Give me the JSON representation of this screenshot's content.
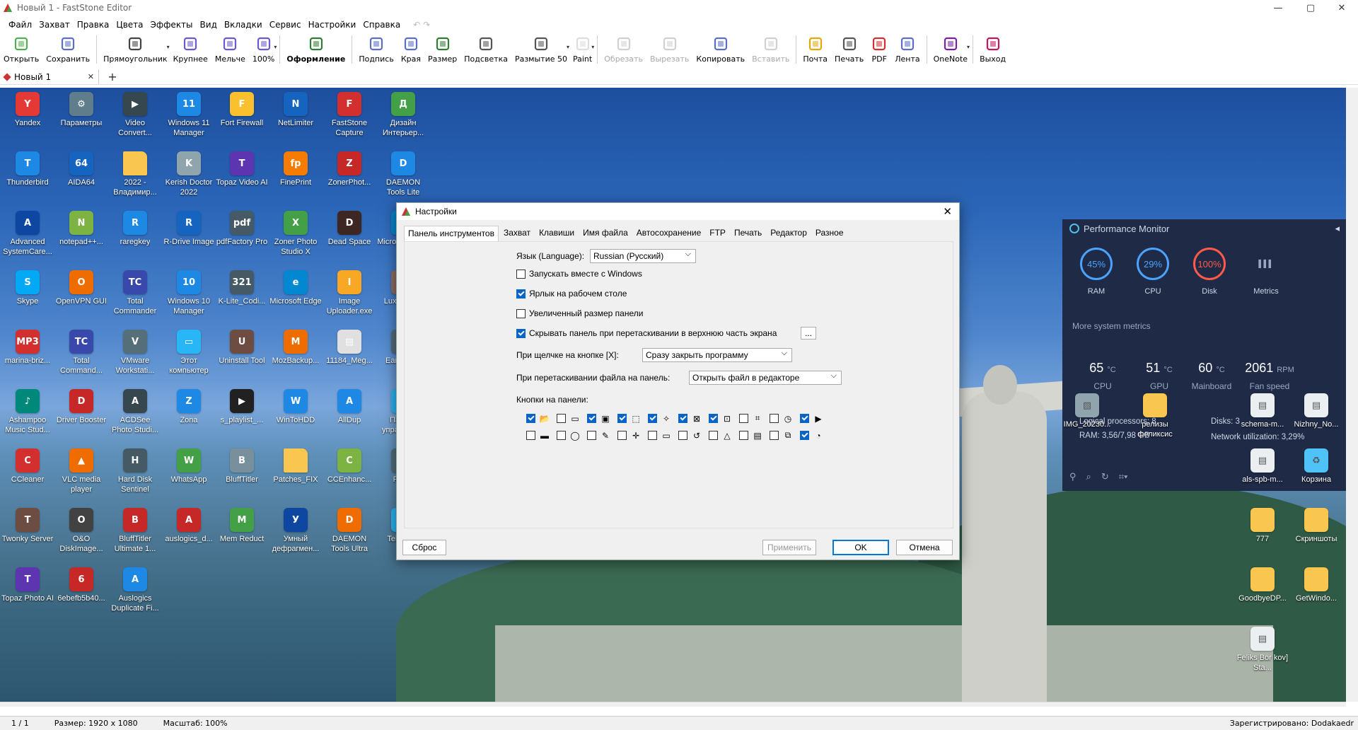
{
  "window": {
    "title": "Новый 1 - FastStone Editor",
    "min": "—",
    "max": "▢",
    "close": "✕"
  },
  "menu": [
    "Файл",
    "Захват",
    "Правка",
    "Цвета",
    "Эффекты",
    "Вид",
    "Вкладки",
    "Сервис",
    "Настройки",
    "Справка"
  ],
  "menu_undo": "↶ ↷",
  "toolbar": [
    {
      "label": "Открыть",
      "icon": "open-icon",
      "color": "#4caf50"
    },
    {
      "label": "Сохранить",
      "icon": "save-icon",
      "color": "#5a6ec9"
    },
    {
      "label": "Прямоугольник",
      "icon": "rectangle-select-icon",
      "color": "#444"
    },
    {
      "label": "Крупнее",
      "icon": "zoom-in-icon",
      "color": "#6a5acd"
    },
    {
      "label": "Мельче",
      "icon": "zoom-out-icon",
      "color": "#6a5acd"
    },
    {
      "label": "100%",
      "icon": "zoom-100-icon",
      "color": "#6a5acd"
    },
    {
      "label": "Оформление",
      "icon": "draw-icon",
      "color": "#2e7d32",
      "bold": true
    },
    {
      "label": "Подпись",
      "icon": "caption-icon",
      "color": "#5a6ec9"
    },
    {
      "label": "Края",
      "icon": "edge-icon",
      "color": "#5a6ec9"
    },
    {
      "label": "Размер",
      "icon": "resize-icon",
      "color": "#2e7d32"
    },
    {
      "label": "Подсветка",
      "icon": "spotlight-icon",
      "color": "#555"
    },
    {
      "label": "Размытие 50",
      "icon": "blur-icon",
      "color": "#555"
    },
    {
      "label": "Paint",
      "icon": "paint-icon",
      "color": "#ddd"
    },
    {
      "label": "Обрезать",
      "icon": "crop-icon",
      "color": "#999",
      "disabled": true
    },
    {
      "label": "Вырезать",
      "icon": "cut-icon",
      "color": "#999",
      "disabled": true
    },
    {
      "label": "Копировать",
      "icon": "copy-icon",
      "color": "#5a6ec9"
    },
    {
      "label": "Вставить",
      "icon": "paste-icon",
      "color": "#999",
      "disabled": true
    },
    {
      "label": "Почта",
      "icon": "mail-icon",
      "color": "#e6a700"
    },
    {
      "label": "Печать",
      "icon": "print-icon",
      "color": "#555"
    },
    {
      "label": "PDF",
      "icon": "pdf-icon",
      "color": "#d32f2f"
    },
    {
      "label": "Лента",
      "icon": "ribbon-icon",
      "color": "#5a6ec9"
    },
    {
      "label": "OneNote",
      "icon": "onenote-icon",
      "color": "#7b1fa2"
    },
    {
      "label": "Выход",
      "icon": "exit-icon",
      "color": "#c2185b"
    }
  ],
  "doc_tab": {
    "name": "Новый 1",
    "close": "✕",
    "add": "+"
  },
  "desktop_icons": [
    {
      "label": "Yandex",
      "color": "#e53935",
      "g": "Y"
    },
    {
      "label": "Параметры",
      "color": "#607d8b",
      "g": "⚙"
    },
    {
      "label": "Video Convert...",
      "color": "#37474f",
      "g": "▶"
    },
    {
      "label": "Windows 11 Manager",
      "color": "#1e88e5",
      "g": "11"
    },
    {
      "label": "Fort Firewall",
      "color": "#fbc02d",
      "g": "F"
    },
    {
      "label": "NetLimiter",
      "color": "#1565c0",
      "g": "N"
    },
    {
      "label": "FastStone Capture",
      "color": "#d32f2f",
      "g": "F"
    },
    {
      "label": "Дизайн Интерьер...",
      "color": "#43a047",
      "g": "Д"
    },
    {
      "label": "Thunderbird",
      "color": "#1e88e5",
      "g": "T"
    },
    {
      "label": "AIDA64",
      "color": "#1565c0",
      "g": "64"
    },
    {
      "label": "2022 - Владимир...",
      "color": "#f9c74f",
      "g": ""
    },
    {
      "label": "Kerish Doctor 2022",
      "color": "#90a4ae",
      "g": "K"
    },
    {
      "label": "Topaz Video AI",
      "color": "#5e35b1",
      "g": "T"
    },
    {
      "label": "FinePrint",
      "color": "#f57c00",
      "g": "fp"
    },
    {
      "label": "ZonerPhot...",
      "color": "#c62828",
      "g": "Z"
    },
    {
      "label": "DAEMON Tools Lite",
      "color": "#1e88e5",
      "g": "D"
    },
    {
      "label": "Advanced SystemCare...",
      "color": "#0d47a1",
      "g": "A"
    },
    {
      "label": "notepad++...",
      "color": "#7cb342",
      "g": "N"
    },
    {
      "label": "raregkey",
      "color": "#1e88e5",
      "g": "R"
    },
    {
      "label": "R-Drive Image",
      "color": "#1565c0",
      "g": "R"
    },
    {
      "label": "pdfFactory Pro",
      "color": "#455a64",
      "g": "pdf"
    },
    {
      "label": "Zoner Photo Studio X",
      "color": "#43a047",
      "g": "X"
    },
    {
      "label": "Dead Space",
      "color": "#3e2723",
      "g": "D"
    },
    {
      "label": "Microsoft Edge",
      "color": "#0288d1",
      "g": "e"
    },
    {
      "label": "Skype",
      "color": "#03a9f4",
      "g": "S"
    },
    {
      "label": "OpenVPN GUI",
      "color": "#ef6c00",
      "g": "O"
    },
    {
      "label": "Total Commander",
      "color": "#3949ab",
      "g": "TC"
    },
    {
      "label": "Windows 10 Manager",
      "color": "#1e88e5",
      "g": "10"
    },
    {
      "label": "K-Lite_Codi...",
      "color": "#455a64",
      "g": "321"
    },
    {
      "label": "Microsoft Edge",
      "color": "#0288d1",
      "g": "e"
    },
    {
      "label": "Image Uploader.exe",
      "color": "#f9a825",
      "g": "I"
    },
    {
      "label": "Luxor3.exe",
      "color": "#8d6e63",
      "g": "L"
    },
    {
      "label": "marina-briz...",
      "color": "#d32f2f",
      "g": "MP3"
    },
    {
      "label": "Total Command...",
      "color": "#3949ab",
      "g": "TC"
    },
    {
      "label": "VMware Workstati...",
      "color": "#546e7a",
      "g": "V"
    },
    {
      "label": "Этот компьютер",
      "color": "#29b6f6",
      "g": "▭"
    },
    {
      "label": "Uninstall Tool",
      "color": "#6d4c41",
      "g": "U"
    },
    {
      "label": "MozBackup...",
      "color": "#ef6c00",
      "g": "M"
    },
    {
      "label": "11184_Meg...",
      "color": "#e0e0e0",
      "g": "▤"
    },
    {
      "label": "EarthView",
      "color": "#546e7a",
      "g": "E"
    },
    {
      "label": "Ashampoo Music Stud...",
      "color": "#00897b",
      "g": "♪"
    },
    {
      "label": "Driver Booster",
      "color": "#c62828",
      "g": "D"
    },
    {
      "label": "ACDSee Photo Studi...",
      "color": "#37474f",
      "g": "A"
    },
    {
      "label": "Zona",
      "color": "#1e88e5",
      "g": "Z"
    },
    {
      "label": "s_playlist_...",
      "color": "#212121",
      "g": "▶"
    },
    {
      "label": "WinToHDD",
      "color": "#1e88e5",
      "g": "W"
    },
    {
      "label": "AllDup",
      "color": "#1e88e5",
      "g": "A"
    },
    {
      "label": "Панель управления",
      "color": "#29b6f6",
      "g": "П"
    },
    {
      "label": "CCleaner",
      "color": "#d32f2f",
      "g": "C"
    },
    {
      "label": "VLC media player",
      "color": "#ef6c00",
      "g": "▲"
    },
    {
      "label": "Hard Disk Sentinel",
      "color": "#455a64",
      "g": "H"
    },
    {
      "label": "WhatsApp",
      "color": "#43a047",
      "g": "W"
    },
    {
      "label": "BluffTitler",
      "color": "#78909c",
      "g": "B"
    },
    {
      "label": "Patches_FIX",
      "color": "#f9c74f",
      "g": ""
    },
    {
      "label": "CCEnhanc...",
      "color": "#7cb342",
      "g": "C"
    },
    {
      "label": "Rufus",
      "color": "#546e7a",
      "g": "R"
    },
    {
      "label": "Twonky Server",
      "color": "#6d4c41",
      "g": "T"
    },
    {
      "label": "O&O DiskImage...",
      "color": "#424242",
      "g": "O"
    },
    {
      "label": "BluffTitler Ultimate 1...",
      "color": "#c62828",
      "g": "B"
    },
    {
      "label": "auslogics_d...",
      "color": "#c62828",
      "g": "A"
    },
    {
      "label": "Mem Reduct",
      "color": "#43a047",
      "g": "M"
    },
    {
      "label": "Умный дефрагмен...",
      "color": "#0d47a1",
      "g": "У"
    },
    {
      "label": "DAEMON Tools Ultra",
      "color": "#ef6c00",
      "g": "D"
    },
    {
      "label": "Telegram",
      "color": "#29b6f6",
      "g": "T"
    },
    {
      "label": "Topaz Photo AI",
      "color": "#5e35b1",
      "g": "T"
    },
    {
      "label": "6ebefb5b40...",
      "color": "#c62828",
      "g": "6"
    },
    {
      "label": "Auslogics Duplicate Fi...",
      "color": "#1e88e5",
      "g": "A"
    }
  ],
  "desktop_right": [
    {
      "label": "IMG_20230...",
      "color": "#90a4ae",
      "g": "▨"
    },
    {
      "label": "релизы феликсис",
      "color": "#f9c74f",
      "g": ""
    },
    {
      "label": "schema-m...",
      "color": "#eceff1",
      "g": "▤"
    },
    {
      "label": "Nizhny_No...",
      "color": "#eceff1",
      "g": "▤"
    },
    {
      "label": "als-spb-m...",
      "color": "#eceff1",
      "g": "▤"
    },
    {
      "label": "Корзина",
      "color": "#4fc3f7",
      "g": "♻"
    },
    {
      "label": "777",
      "color": "#f9c74f",
      "g": ""
    },
    {
      "label": "Скриншоты",
      "color": "#f9c74f",
      "g": ""
    },
    {
      "label": "GoodbyeDP...",
      "color": "#f9c74f",
      "g": ""
    },
    {
      "label": "GetWindo...",
      "color": "#f9c74f",
      "g": ""
    },
    {
      "label": "Feliks Bor kov] Sta...",
      "color": "#eceff1",
      "g": "▤"
    }
  ],
  "perf": {
    "title": "Performance Monitor",
    "gauges": [
      {
        "label": "RAM",
        "value": "45%",
        "color": "#4aa3ff"
      },
      {
        "label": "CPU",
        "value": "29%",
        "color": "#4aa3ff"
      },
      {
        "label": "Disk",
        "value": "100%",
        "color": "#ff5a4a"
      },
      {
        "label": "Metrics",
        "value": "▌▌▌",
        "color": "#9aa6c2"
      }
    ],
    "more": "More system metrics",
    "temps": [
      {
        "value": "65",
        "unit": "°C",
        "label": "CPU"
      },
      {
        "value": "51",
        "unit": "°C",
        "label": "GPU"
      },
      {
        "value": "60",
        "unit": "°C",
        "label": "Mainboard"
      },
      {
        "value": "2061",
        "unit": "RPM",
        "label": "Fan speed"
      }
    ],
    "logical": "Logical processors:  8",
    "ram": "RAM:  3,56/7,98 GB",
    "disks": "Disks:  3",
    "net": "Network utilization:  3,29%",
    "collapse": "◂"
  },
  "dialog": {
    "title": "Настройки",
    "close": "✕",
    "tabs": [
      "Панель инструментов",
      "Захват",
      "Клавиши",
      "Имя файла",
      "Автосохранение",
      "FTP",
      "Печать",
      "Редактор",
      "Разное"
    ],
    "lang_label": "Язык (Language):",
    "lang_value": "Russian (Русский)",
    "checks": [
      {
        "label": "Запускать вместе с Windows",
        "on": false
      },
      {
        "label": "Ярлык на рабочем столе",
        "on": true
      },
      {
        "label": "Увеличенный размер панели",
        "on": false
      },
      {
        "label": "Скрывать панель при перетаскивании в верхнюю часть экрана",
        "on": true
      }
    ],
    "more_btn": "...",
    "close_label": "При щелчке на кнопке [X]:",
    "close_value": "Сразу закрыть программу",
    "drag_label": "При перетаскивании файла на панель:",
    "drag_value": "Открыть файл в редакторе",
    "buttons_label": "Кнопки на панели:",
    "panel_buttons": [
      [
        {
          "on": true,
          "g": "📂"
        },
        {
          "on": false,
          "g": "▭"
        },
        {
          "on": true,
          "g": "▣"
        },
        {
          "on": true,
          "g": "⬚"
        },
        {
          "on": true,
          "g": "✧"
        },
        {
          "on": true,
          "g": "⊠"
        },
        {
          "on": true,
          "g": "⊡"
        },
        {
          "on": false,
          "g": "⌗"
        },
        {
          "on": false,
          "g": "◷"
        },
        {
          "on": true,
          "g": "▶"
        }
      ],
      [
        {
          "on": false,
          "g": "▬"
        },
        {
          "on": false,
          "g": "◯"
        },
        {
          "on": false,
          "g": "✎"
        },
        {
          "on": false,
          "g": "✛"
        },
        {
          "on": false,
          "g": "▭"
        },
        {
          "on": false,
          "g": "↺"
        },
        {
          "on": false,
          "g": "△"
        },
        {
          "on": false,
          "g": "▤"
        },
        {
          "on": false,
          "g": "⧉"
        },
        {
          "on": true,
          "g": "◔"
        }
      ]
    ],
    "reset": "Сброс",
    "apply": "Применить",
    "ok": "OK",
    "cancel": "Отмена"
  },
  "status": {
    "page": "1 / 1",
    "size": "Размер: 1920 x 1080",
    "zoom": "Масштаб: 100%",
    "reg": "Зарегистрировано: Dodakaedr"
  }
}
